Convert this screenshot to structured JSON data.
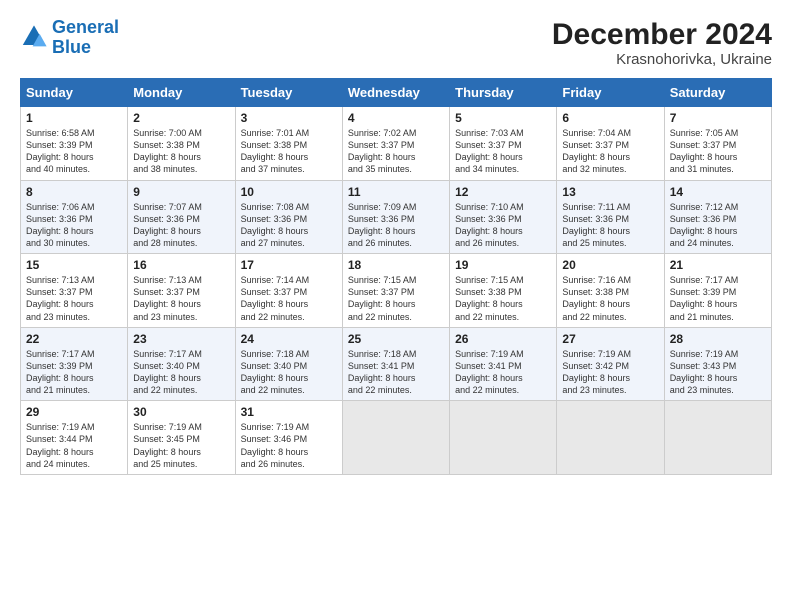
{
  "header": {
    "logo_line1": "General",
    "logo_line2": "Blue",
    "title": "December 2024",
    "subtitle": "Krasnohorivka, Ukraine"
  },
  "days_of_week": [
    "Sunday",
    "Monday",
    "Tuesday",
    "Wednesday",
    "Thursday",
    "Friday",
    "Saturday"
  ],
  "weeks": [
    [
      {
        "day": 1,
        "lines": [
          "Sunrise: 6:58 AM",
          "Sunset: 3:39 PM",
          "Daylight: 8 hours",
          "and 40 minutes."
        ]
      },
      {
        "day": 2,
        "lines": [
          "Sunrise: 7:00 AM",
          "Sunset: 3:38 PM",
          "Daylight: 8 hours",
          "and 38 minutes."
        ]
      },
      {
        "day": 3,
        "lines": [
          "Sunrise: 7:01 AM",
          "Sunset: 3:38 PM",
          "Daylight: 8 hours",
          "and 37 minutes."
        ]
      },
      {
        "day": 4,
        "lines": [
          "Sunrise: 7:02 AM",
          "Sunset: 3:37 PM",
          "Daylight: 8 hours",
          "and 35 minutes."
        ]
      },
      {
        "day": 5,
        "lines": [
          "Sunrise: 7:03 AM",
          "Sunset: 3:37 PM",
          "Daylight: 8 hours",
          "and 34 minutes."
        ]
      },
      {
        "day": 6,
        "lines": [
          "Sunrise: 7:04 AM",
          "Sunset: 3:37 PM",
          "Daylight: 8 hours",
          "and 32 minutes."
        ]
      },
      {
        "day": 7,
        "lines": [
          "Sunrise: 7:05 AM",
          "Sunset: 3:37 PM",
          "Daylight: 8 hours",
          "and 31 minutes."
        ]
      }
    ],
    [
      {
        "day": 8,
        "lines": [
          "Sunrise: 7:06 AM",
          "Sunset: 3:36 PM",
          "Daylight: 8 hours",
          "and 30 minutes."
        ]
      },
      {
        "day": 9,
        "lines": [
          "Sunrise: 7:07 AM",
          "Sunset: 3:36 PM",
          "Daylight: 8 hours",
          "and 28 minutes."
        ]
      },
      {
        "day": 10,
        "lines": [
          "Sunrise: 7:08 AM",
          "Sunset: 3:36 PM",
          "Daylight: 8 hours",
          "and 27 minutes."
        ]
      },
      {
        "day": 11,
        "lines": [
          "Sunrise: 7:09 AM",
          "Sunset: 3:36 PM",
          "Daylight: 8 hours",
          "and 26 minutes."
        ]
      },
      {
        "day": 12,
        "lines": [
          "Sunrise: 7:10 AM",
          "Sunset: 3:36 PM",
          "Daylight: 8 hours",
          "and 26 minutes."
        ]
      },
      {
        "day": 13,
        "lines": [
          "Sunrise: 7:11 AM",
          "Sunset: 3:36 PM",
          "Daylight: 8 hours",
          "and 25 minutes."
        ]
      },
      {
        "day": 14,
        "lines": [
          "Sunrise: 7:12 AM",
          "Sunset: 3:36 PM",
          "Daylight: 8 hours",
          "and 24 minutes."
        ]
      }
    ],
    [
      {
        "day": 15,
        "lines": [
          "Sunrise: 7:13 AM",
          "Sunset: 3:37 PM",
          "Daylight: 8 hours",
          "and 23 minutes."
        ]
      },
      {
        "day": 16,
        "lines": [
          "Sunrise: 7:13 AM",
          "Sunset: 3:37 PM",
          "Daylight: 8 hours",
          "and 23 minutes."
        ]
      },
      {
        "day": 17,
        "lines": [
          "Sunrise: 7:14 AM",
          "Sunset: 3:37 PM",
          "Daylight: 8 hours",
          "and 22 minutes."
        ]
      },
      {
        "day": 18,
        "lines": [
          "Sunrise: 7:15 AM",
          "Sunset: 3:37 PM",
          "Daylight: 8 hours",
          "and 22 minutes."
        ]
      },
      {
        "day": 19,
        "lines": [
          "Sunrise: 7:15 AM",
          "Sunset: 3:38 PM",
          "Daylight: 8 hours",
          "and 22 minutes."
        ]
      },
      {
        "day": 20,
        "lines": [
          "Sunrise: 7:16 AM",
          "Sunset: 3:38 PM",
          "Daylight: 8 hours",
          "and 22 minutes."
        ]
      },
      {
        "day": 21,
        "lines": [
          "Sunrise: 7:17 AM",
          "Sunset: 3:39 PM",
          "Daylight: 8 hours",
          "and 21 minutes."
        ]
      }
    ],
    [
      {
        "day": 22,
        "lines": [
          "Sunrise: 7:17 AM",
          "Sunset: 3:39 PM",
          "Daylight: 8 hours",
          "and 21 minutes."
        ]
      },
      {
        "day": 23,
        "lines": [
          "Sunrise: 7:17 AM",
          "Sunset: 3:40 PM",
          "Daylight: 8 hours",
          "and 22 minutes."
        ]
      },
      {
        "day": 24,
        "lines": [
          "Sunrise: 7:18 AM",
          "Sunset: 3:40 PM",
          "Daylight: 8 hours",
          "and 22 minutes."
        ]
      },
      {
        "day": 25,
        "lines": [
          "Sunrise: 7:18 AM",
          "Sunset: 3:41 PM",
          "Daylight: 8 hours",
          "and 22 minutes."
        ]
      },
      {
        "day": 26,
        "lines": [
          "Sunrise: 7:19 AM",
          "Sunset: 3:41 PM",
          "Daylight: 8 hours",
          "and 22 minutes."
        ]
      },
      {
        "day": 27,
        "lines": [
          "Sunrise: 7:19 AM",
          "Sunset: 3:42 PM",
          "Daylight: 8 hours",
          "and 23 minutes."
        ]
      },
      {
        "day": 28,
        "lines": [
          "Sunrise: 7:19 AM",
          "Sunset: 3:43 PM",
          "Daylight: 8 hours",
          "and 23 minutes."
        ]
      }
    ],
    [
      {
        "day": 29,
        "lines": [
          "Sunrise: 7:19 AM",
          "Sunset: 3:44 PM",
          "Daylight: 8 hours",
          "and 24 minutes."
        ]
      },
      {
        "day": 30,
        "lines": [
          "Sunrise: 7:19 AM",
          "Sunset: 3:45 PM",
          "Daylight: 8 hours",
          "and 25 minutes."
        ]
      },
      {
        "day": 31,
        "lines": [
          "Sunrise: 7:19 AM",
          "Sunset: 3:46 PM",
          "Daylight: 8 hours",
          "and 26 minutes."
        ]
      },
      null,
      null,
      null,
      null
    ]
  ]
}
